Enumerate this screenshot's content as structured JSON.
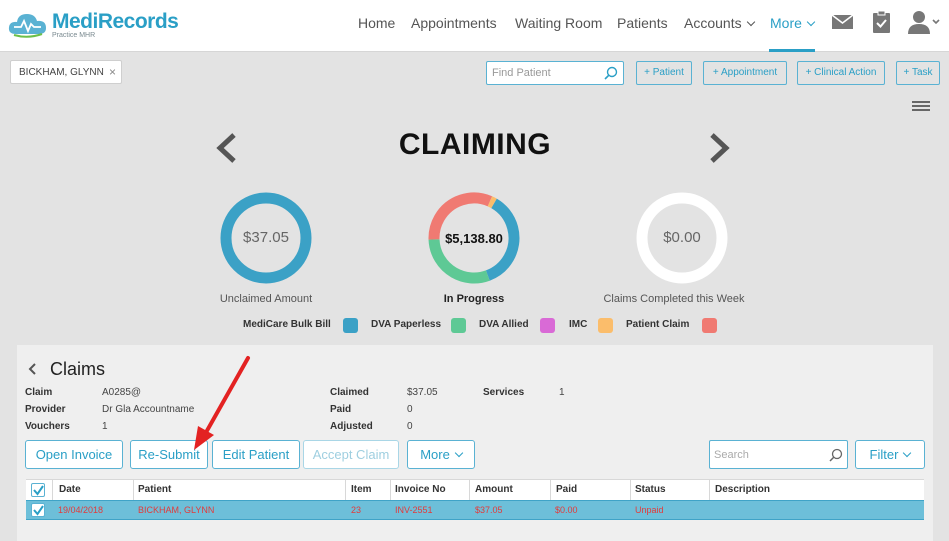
{
  "app": {
    "logo_text": "MediRecords",
    "logo_subtitle": "Practice MHR"
  },
  "nav": {
    "items": [
      {
        "label": "Home"
      },
      {
        "label": "Appointments"
      },
      {
        "label": "Waiting Room"
      },
      {
        "label": "Patients"
      },
      {
        "label": "Accounts",
        "dropdown": true
      },
      {
        "label": "More",
        "dropdown": true,
        "active": true
      }
    ],
    "icons": [
      "mail-icon",
      "clipboard-check-icon",
      "user-icon"
    ]
  },
  "patient_bar": {
    "current_patient": "BICKHAM, GLYNN",
    "close_glyph": "×",
    "find_placeholder": "Find Patient",
    "quick_actions": [
      "+ Patient",
      "+ Appointment",
      "+ Clinical Action",
      "+ Task"
    ]
  },
  "claiming": {
    "title": "CLAIMING",
    "summaries": [
      {
        "value": "$37.05",
        "label": "Unclaimed Amount",
        "bold": false
      },
      {
        "value": "$5,138.80",
        "label": "In Progress",
        "bold": true
      },
      {
        "value": "$0.00",
        "label": "Claims Completed this Week",
        "bold": false
      }
    ],
    "in_progress_share": [
      {
        "name": "MediCare Bulk Bill",
        "fraction": 0.36
      },
      {
        "name": "DVA Paperless",
        "fraction": 0.3
      },
      {
        "name": "IMC",
        "fraction": 0.02
      },
      {
        "name": "Patient Claim",
        "fraction": 0.32
      }
    ],
    "legend": [
      {
        "label": "MediCare Bulk Bill",
        "color": "#3ba1c6"
      },
      {
        "label": "DVA Paperless",
        "color": "#5ec995"
      },
      {
        "label": "DVA Allied",
        "color": "#d96ad6"
      },
      {
        "label": "IMC",
        "color": "#fbbd6b"
      },
      {
        "label": "Patient Claim",
        "color": "#f07a72"
      }
    ],
    "colors": {
      "unclaimed_ring": "#3ba1c6",
      "completed_ring": "#ffffff"
    }
  },
  "claims_panel": {
    "title": "Claims",
    "fields": {
      "claim_label": "Claim",
      "claim_value": "A0285@",
      "provider_label": "Provider",
      "provider_value": "Dr Gla Accountname",
      "vouchers_label": "Vouchers",
      "vouchers_value": "1",
      "claimed_label": "Claimed",
      "claimed_value": "$37.05",
      "paid_label": "Paid",
      "paid_value": "0",
      "adjusted_label": "Adjusted",
      "adjusted_value": "0",
      "services_label": "Services",
      "services_value": "1"
    },
    "actions": {
      "open_invoice": "Open Invoice",
      "resubmit": "Re-Submit",
      "edit_patient": "Edit Patient",
      "accept_claim": "Accept Claim",
      "more": "More",
      "search_placeholder": "Search",
      "filter": "Filter"
    },
    "table": {
      "columns": [
        "Date",
        "Patient",
        "Item",
        "Invoice No",
        "Amount",
        "Paid",
        "Status",
        "Description"
      ],
      "rows": [
        {
          "selected": true,
          "date": "19/04/2018",
          "patient": "BICKHAM, GLYNN",
          "item": "23",
          "invoice_no": "INV-2551",
          "amount": "$37.05",
          "paid": "$0.00",
          "status": "Unpaid",
          "description": ""
        }
      ]
    }
  }
}
